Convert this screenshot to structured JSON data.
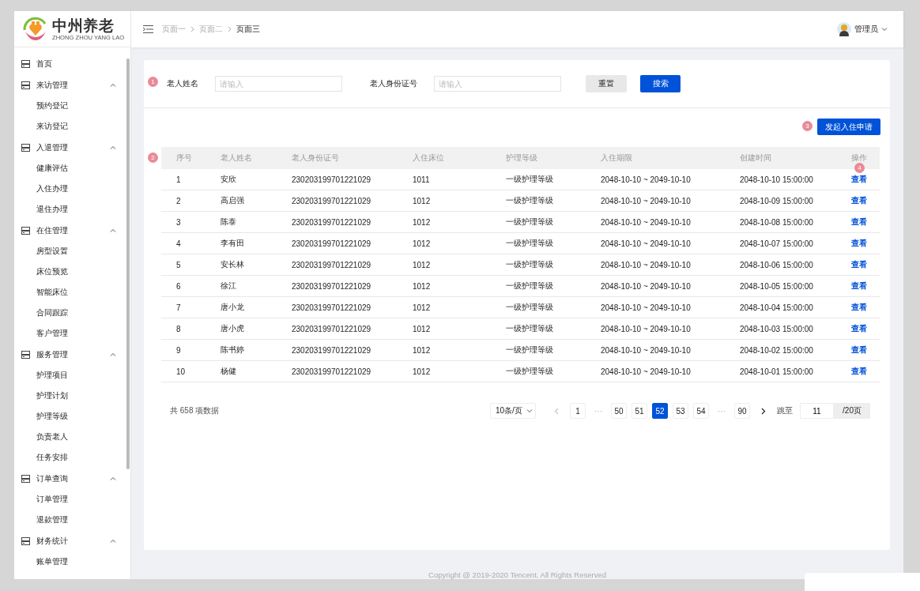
{
  "logo": {
    "title": "中州养老",
    "subtitle": "ZHONG ZHOU YANG LAO"
  },
  "sidebar": {
    "items": [
      {
        "label": "首页"
      },
      {
        "label": "来访管理",
        "expanded": true,
        "children": [
          {
            "label": "预约登记"
          },
          {
            "label": "来访登记"
          }
        ]
      },
      {
        "label": "入退管理",
        "expanded": true,
        "children": [
          {
            "label": "健康评估"
          },
          {
            "label": "入住办理"
          },
          {
            "label": "退住办理"
          }
        ]
      },
      {
        "label": "在住管理",
        "expanded": true,
        "children": [
          {
            "label": "房型设置"
          },
          {
            "label": "床位预览"
          },
          {
            "label": "智能床位"
          },
          {
            "label": "合同跟踪"
          },
          {
            "label": "客户管理"
          }
        ]
      },
      {
        "label": "服务管理",
        "expanded": true,
        "children": [
          {
            "label": "护理项目"
          },
          {
            "label": "护理计划"
          },
          {
            "label": "护理等级"
          },
          {
            "label": "负责老人"
          },
          {
            "label": "任务安排"
          }
        ]
      },
      {
        "label": "订单查询",
        "expanded": true,
        "children": [
          {
            "label": "订单管理"
          },
          {
            "label": "退款管理"
          }
        ]
      },
      {
        "label": "财务统计",
        "expanded": true,
        "children": [
          {
            "label": "账单管理"
          }
        ]
      }
    ]
  },
  "header": {
    "breadcrumbs": [
      {
        "label": "页面一",
        "current": false
      },
      {
        "label": "页面二",
        "current": false
      },
      {
        "label": "页面三",
        "current": true
      }
    ],
    "user": {
      "name": "管理员"
    }
  },
  "search": {
    "marker": "1",
    "fields": [
      {
        "label": "老人姓名",
        "placeholder": "请输入"
      },
      {
        "label": "老人身份证号",
        "placeholder": "请输入"
      }
    ],
    "buttons": [
      {
        "label": "重置",
        "kind": "secondary"
      },
      {
        "label": "搜索",
        "kind": "primary"
      }
    ]
  },
  "toolbar": {
    "marker": "3",
    "button": "发起入住申请"
  },
  "table": {
    "marker": "2",
    "action_marker": "4",
    "columns": [
      "序号",
      "老人姓名",
      "老人身份证号",
      "入住床位",
      "护理等级",
      "入住期限",
      "创建时间",
      "操作"
    ],
    "rows": [
      {
        "cells": [
          "1",
          "安欣",
          "230203199701221029",
          "1011",
          "一级护理等级",
          "2048-10-10 ~ 2049-10-10",
          "2048-10-10 15:00:00"
        ],
        "action": "查看"
      },
      {
        "cells": [
          "2",
          "高启强",
          "230203199701221029",
          "1012",
          "一级护理等级",
          "2048-10-10 ~ 2049-10-10",
          "2048-10-09 15:00:00"
        ],
        "action": "查看"
      },
      {
        "cells": [
          "3",
          "陈泰",
          "230203199701221029",
          "1012",
          "一级护理等级",
          "2048-10-10 ~ 2049-10-10",
          "2048-10-08 15:00:00"
        ],
        "action": "查看"
      },
      {
        "cells": [
          "4",
          "李有田",
          "230203199701221029",
          "1012",
          "一级护理等级",
          "2048-10-10 ~ 2049-10-10",
          "2048-10-07 15:00:00"
        ],
        "action": "查看"
      },
      {
        "cells": [
          "5",
          "安长林",
          "230203199701221029",
          "1012",
          "一级护理等级",
          "2048-10-10 ~ 2049-10-10",
          "2048-10-06 15:00:00"
        ],
        "action": "查看"
      },
      {
        "cells": [
          "6",
          "徐江",
          "230203199701221029",
          "1012",
          "一级护理等级",
          "2048-10-10 ~ 2049-10-10",
          "2048-10-05 15:00:00"
        ],
        "action": "查看"
      },
      {
        "cells": [
          "7",
          "唐小龙",
          "230203199701221029",
          "1012",
          "一级护理等级",
          "2048-10-10 ~ 2049-10-10",
          "2048-10-04 15:00:00"
        ],
        "action": "查看"
      },
      {
        "cells": [
          "8",
          "唐小虎",
          "230203199701221029",
          "1012",
          "一级护理等级",
          "2048-10-10 ~ 2049-10-10",
          "2048-10-03 15:00:00"
        ],
        "action": "查看"
      },
      {
        "cells": [
          "9",
          "陈书婷",
          "230203199701221029",
          "1012",
          "一级护理等级",
          "2048-10-10 ~ 2049-10-10",
          "2048-10-02 15:00:00"
        ],
        "action": "查看"
      },
      {
        "cells": [
          "10",
          "杨健",
          "230203199701221029",
          "1012",
          "一级护理等级",
          "2048-10-10 ~ 2049-10-10",
          "2048-10-01 15:00:00"
        ],
        "action": "查看"
      }
    ]
  },
  "pagination": {
    "total": "共 658 项数据",
    "page_size": "10条/页",
    "prev_disabled": true,
    "next_disabled": false,
    "pages": [
      {
        "label": "1",
        "kind": "page",
        "selected": false
      },
      {
        "label": "···",
        "kind": "ellipsis"
      },
      {
        "label": "50",
        "kind": "page",
        "selected": false
      },
      {
        "label": "51",
        "kind": "page",
        "selected": false
      },
      {
        "label": "52",
        "kind": "page",
        "selected": true
      },
      {
        "label": "53",
        "kind": "page",
        "selected": false
      },
      {
        "label": "54",
        "kind": "page",
        "selected": false
      },
      {
        "label": "···",
        "kind": "ellipsis"
      },
      {
        "label": "90",
        "kind": "page",
        "selected": false
      }
    ],
    "jump_label": "跳至",
    "jump_value": "11",
    "jump_suffix": "/20页"
  },
  "footer": "Copyright @ 2019-2020 Tencent. All Rights Reserved"
}
